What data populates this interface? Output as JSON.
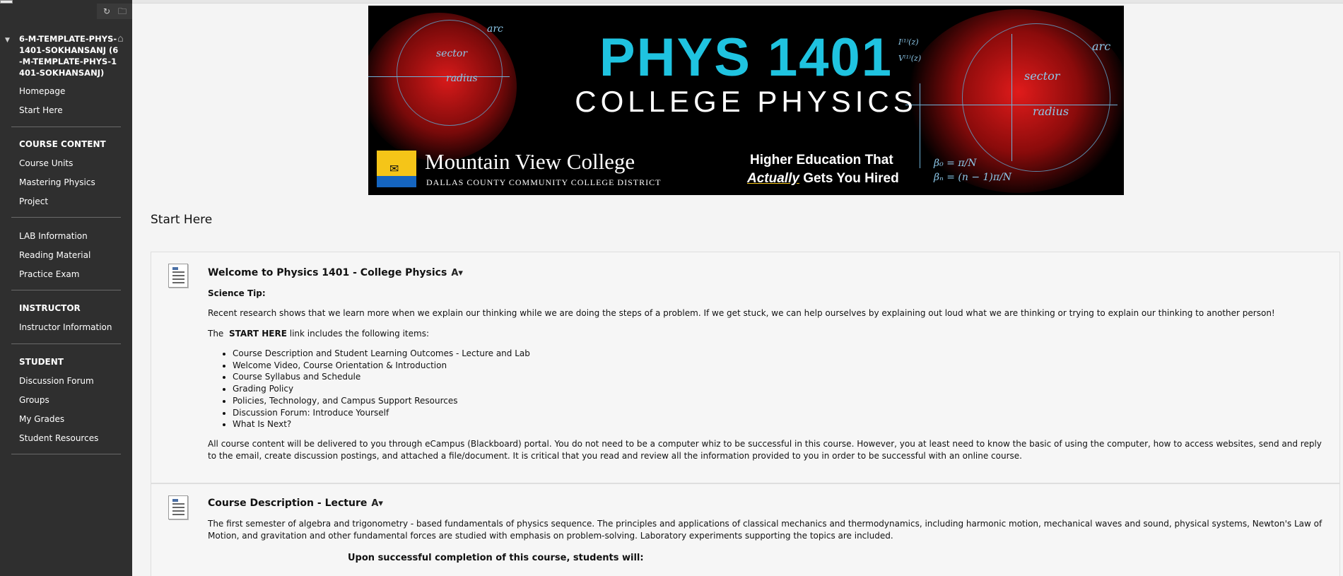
{
  "course": {
    "title": "6-M-TEMPLATE-PHYS-1401-SOKHANSANJ (6-M-TEMPLATE-PHYS-1401-SOKHANSANJ)"
  },
  "sidebar": {
    "top_items": [
      "Homepage",
      "Start Here"
    ],
    "sections": [
      {
        "heading": "COURSE CONTENT",
        "items": [
          "Course Units",
          "Mastering Physics",
          "Project"
        ]
      },
      {
        "heading": "",
        "items": [
          "LAB Information",
          "Reading Material",
          "Practice Exam"
        ]
      },
      {
        "heading": "INSTRUCTOR",
        "items": [
          "Instructor Information"
        ]
      },
      {
        "heading": "STUDENT",
        "items": [
          "Discussion Forum",
          "Groups",
          "My Grades",
          "Student Resources"
        ]
      }
    ]
  },
  "banner": {
    "title": "PHYS 1401",
    "subtitle": "COLLEGE PHYSICS",
    "college_name": "Mountain View College",
    "district": "DALLAS COUNTY COMMUNITY COLLEGE DISTRICT",
    "tagline_line1": "Higher Education That",
    "tagline_emph": "Actually",
    "tagline_line2_rest": " Gets You Hired",
    "accent_color": "#1fc3e0"
  },
  "page": {
    "title": "Start Here"
  },
  "items": [
    {
      "title": "Welcome to Physics 1401 - College Physics",
      "science_tip_label": "Science Tip:",
      "tip": "Recent research shows that we learn more when we explain our thinking while we are doing the steps of a problem. If we get stuck, we can help ourselves by explaining out loud what we are thinking or trying to explain our thinking to another person!",
      "intro_prefix": "The",
      "intro_bold": "START HERE",
      "intro_suffix": "link includes the following items:",
      "list": [
        "Course Description and Student Learning Outcomes - Lecture and Lab",
        "Welcome Video, Course Orientation & Introduction",
        "Course Syllabus and Schedule",
        "Grading Policy",
        "Policies, Technology, and Campus Support Resources",
        "Discussion Forum: Introduce Yourself",
        "What Is Next?"
      ],
      "footer": "All course content will be delivered to you through eCampus (Blackboard) portal. You do not need to be a computer whiz to be successful in this course. However, you at least need to know the basic of using the computer, how to access websites, send and reply to the email, create discussion postings, and attached a file/document. It is critical that you read and review all the information provided to you in order to be successful with an online course."
    },
    {
      "title": "Course Description - Lecture",
      "body": "The first semester of algebra and trigonometry - based fundamentals of physics sequence. The principles and applications of classical mechanics and thermodynamics, including harmonic motion, mechanical waves and sound, physical systems, Newton's Law of Motion, and gravitation and other fundamental forces are studied with emphasis on problem-solving. Laboratory experiments supporting the topics are included.",
      "outcomes_heading": "Upon successful completion of this course, students will:"
    }
  ]
}
